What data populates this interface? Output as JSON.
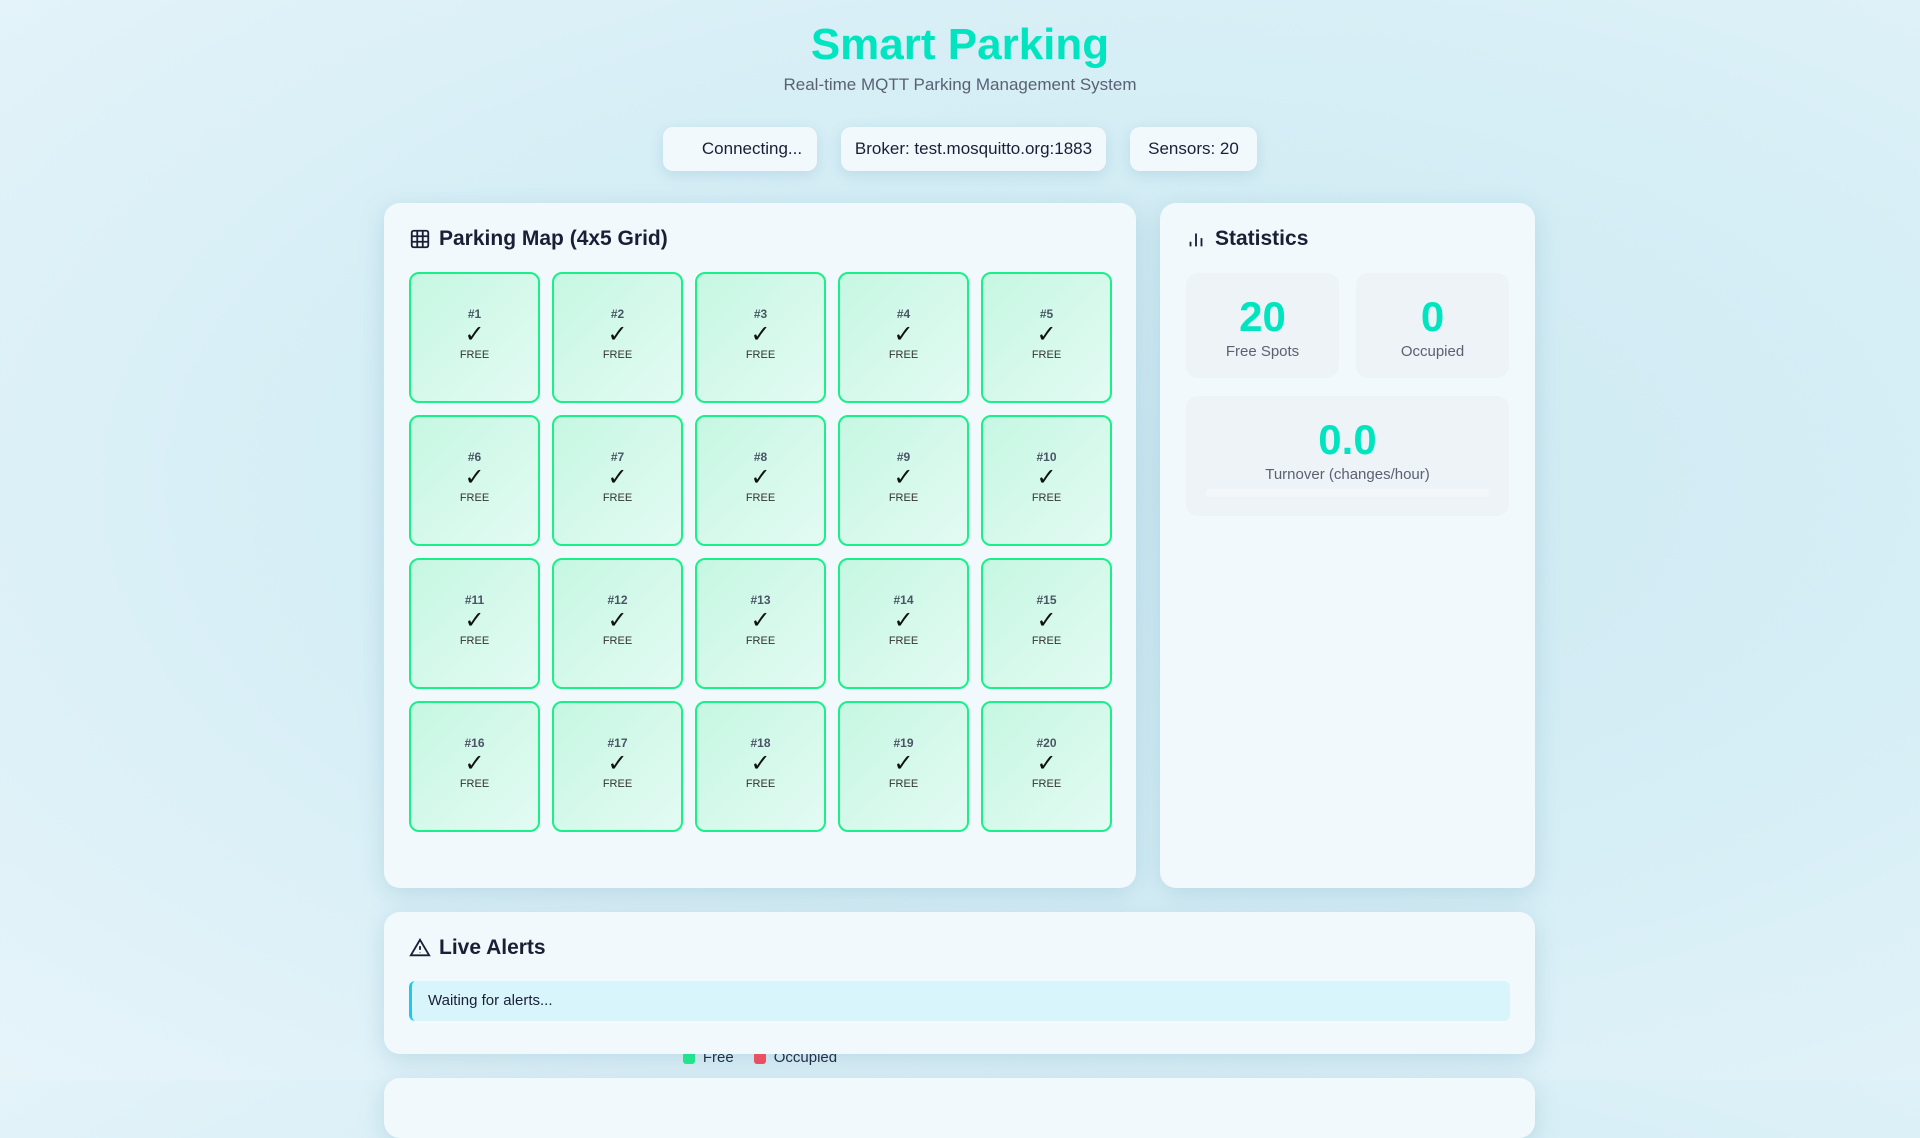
{
  "header": {
    "title": "Smart Parking",
    "subtitle": "Real-time MQTT Parking Management System"
  },
  "status": {
    "connection": "Connecting...",
    "broker": "Broker: test.mosquitto.org:1883",
    "sensors": "Sensors: 20"
  },
  "map": {
    "title": "Parking Map (4x5 Grid)",
    "icon": "grid-icon",
    "spots": [
      {
        "label": "#1",
        "symbol": "✓",
        "status": "FREE"
      },
      {
        "label": "#2",
        "symbol": "✓",
        "status": "FREE"
      },
      {
        "label": "#3",
        "symbol": "✓",
        "status": "FREE"
      },
      {
        "label": "#4",
        "symbol": "✓",
        "status": "FREE"
      },
      {
        "label": "#5",
        "symbol": "✓",
        "status": "FREE"
      },
      {
        "label": "#6",
        "symbol": "✓",
        "status": "FREE"
      },
      {
        "label": "#7",
        "symbol": "✓",
        "status": "FREE"
      },
      {
        "label": "#8",
        "symbol": "✓",
        "status": "FREE"
      },
      {
        "label": "#9",
        "symbol": "✓",
        "status": "FREE"
      },
      {
        "label": "#10",
        "symbol": "✓",
        "status": "FREE"
      },
      {
        "label": "#11",
        "symbol": "✓",
        "status": "FREE"
      },
      {
        "label": "#12",
        "symbol": "✓",
        "status": "FREE"
      },
      {
        "label": "#13",
        "symbol": "✓",
        "status": "FREE"
      },
      {
        "label": "#14",
        "symbol": "✓",
        "status": "FREE"
      },
      {
        "label": "#15",
        "symbol": "✓",
        "status": "FREE"
      },
      {
        "label": "#16",
        "symbol": "✓",
        "status": "FREE"
      },
      {
        "label": "#17",
        "symbol": "✓",
        "status": "FREE"
      },
      {
        "label": "#18",
        "symbol": "✓",
        "status": "FREE"
      },
      {
        "label": "#19",
        "symbol": "✓",
        "status": "FREE"
      },
      {
        "label": "#20",
        "symbol": "✓",
        "status": "FREE"
      }
    ],
    "legend": {
      "free": "Free",
      "occupied": "Occupied",
      "free_color": "#19f08a",
      "occupied_color": "#ff4757"
    }
  },
  "stats": {
    "title": "Statistics",
    "icon": "bar-chart-icon",
    "free_value": "20",
    "free_label": "Free Spots",
    "occupied_value": "0",
    "occupied_label": "Occupied",
    "turnover_value": "0.0",
    "turnover_label": "Turnover (changes/hour)",
    "turnover_progress": 0
  },
  "alerts": {
    "title": "Live Alerts",
    "icon": "warning-icon",
    "message": "Waiting for alerts..."
  }
}
